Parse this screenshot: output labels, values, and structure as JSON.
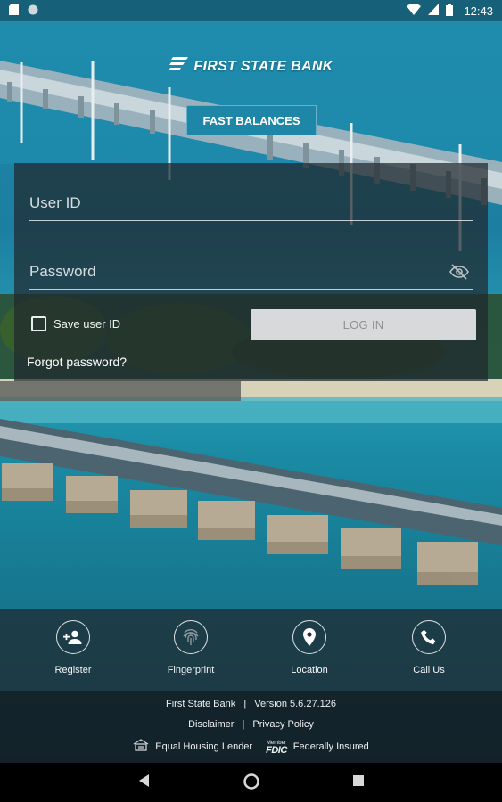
{
  "status_bar": {
    "time": "12:43",
    "left_icons": [
      "sd-card-icon",
      "circle-notification-icon"
    ],
    "right_icons": [
      "wifi-icon",
      "signal-icon",
      "battery-icon"
    ]
  },
  "brand": {
    "name": "FIRST STATE BANK",
    "accent_color": "#1e86a6"
  },
  "fast_balances": {
    "label": "FAST BALANCES"
  },
  "login": {
    "user_id_placeholder": "User ID",
    "user_id_value": "",
    "password_placeholder": "Password",
    "password_value": "",
    "save_user_id_label": "Save user ID",
    "save_user_id_checked": false,
    "login_button_label": "LOG IN",
    "forgot_password_label": "Forgot password?"
  },
  "actions": [
    {
      "label": "Register",
      "icon": "add-user-icon"
    },
    {
      "label": "Fingerprint",
      "icon": "fingerprint-icon"
    },
    {
      "label": "Location",
      "icon": "location-pin-icon"
    },
    {
      "label": "Call Us",
      "icon": "phone-icon"
    }
  ],
  "footer": {
    "bank_name": "First State Bank",
    "version": "Version 5.6.27.126",
    "disclaimer": "Disclaimer",
    "privacy_policy": "Privacy Policy",
    "equal_housing": "Equal Housing Lender",
    "fdic_member": "Member",
    "fdic_logo_text": "FDIC",
    "federally_insured": "Federally Insured"
  },
  "nav_bar": {
    "buttons": [
      "back-icon",
      "home-icon",
      "recents-icon"
    ]
  }
}
